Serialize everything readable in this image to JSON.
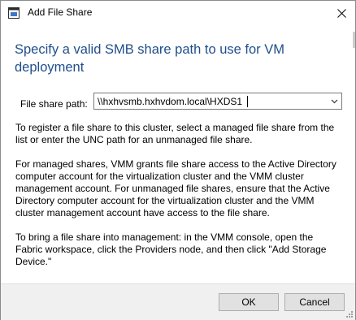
{
  "window": {
    "title": "Add File Share",
    "close_symbol": "✕"
  },
  "heading": "Specify a valid SMB share path to use for VM deployment",
  "file_share": {
    "label": "File share path:",
    "value": "\\\\hxhvsmb.hxhvdom.local\\HXDS1"
  },
  "paragraphs": {
    "p1": "To register a file share to this cluster, select a managed file share from the list or enter the UNC path for an unmanaged file share.",
    "p2": "For managed shares, VMM grants file share access to the Active Directory computer account for the virtualization cluster and the VMM cluster management account. For unmanaged file shares, ensure that the Active Directory computer account for the virtualization cluster and the VMM cluster management account have access to the file share.",
    "p3": "To bring a file share into management: in the VMM console, open the Fabric workspace, click the Providers node, and then click \"Add Storage Device.\""
  },
  "buttons": {
    "ok": "OK",
    "cancel": "Cancel"
  },
  "icons": {
    "title": "app-window-icon",
    "close": "close-icon",
    "dropdown": "chevron-down-icon",
    "grip": "resize-grip-icon"
  },
  "colors": {
    "heading": "#1f4e8c",
    "footer": "#f0f0f0"
  }
}
